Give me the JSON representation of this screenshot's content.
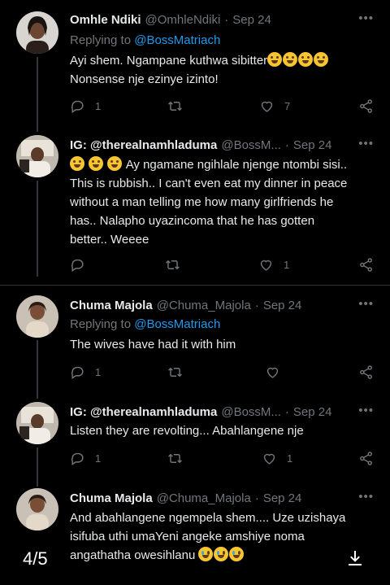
{
  "tweets": [
    {
      "name": "Omhle Ndiki",
      "handle": "@OmhleNdiki",
      "time": "Sep 24",
      "replying_prefix": "Replying to",
      "replying_to": "@BossMatriach",
      "lines": [
        "Ayi shem. Ngampane kuthwa sibitter",
        "Nonsense nje ezinye izinto!"
      ],
      "replies": "1",
      "retweets": "",
      "likes": "7"
    },
    {
      "name": "IG: @therealnamhladuma",
      "handle": "@BossM...",
      "time": "Sep 24",
      "lines": [
        "Ay ngamane ngihlale njenge ntombi sisi..",
        "This is rubbish.. I can't even eat my dinner in peace",
        "without a man telling me how many girlfriends he",
        "has.. Nalapho uyazincoma that he has gotten",
        "better.. Weeee"
      ],
      "replies": "",
      "retweets": "",
      "likes": "1"
    },
    {
      "name": "Chuma Majola",
      "handle": "@Chuma_Majola",
      "time": "Sep 24",
      "replying_prefix": "Replying to",
      "replying_to": "@BossMatriach",
      "lines": [
        "The wives have had it with him"
      ],
      "replies": "1",
      "retweets": "",
      "likes": ""
    },
    {
      "name": "IG: @therealnamhladuma",
      "handle": "@BossM...",
      "time": "Sep 24",
      "lines": [
        "Listen they are revolting... Abahlangene nje"
      ],
      "replies": "1",
      "retweets": "",
      "likes": "1"
    },
    {
      "name": "Chuma Majola",
      "handle": "@Chuma_Majola",
      "time": "Sep 24",
      "lines": [
        "And abahlangene ngempela shem.... Uze uzishaya",
        "isifuba uthi umaYeni angeke amshiye noma",
        "angathatha owesihlanu"
      ]
    }
  ],
  "viewer": {
    "counter": "4/5"
  },
  "colors": {
    "background": "#000000",
    "accent": "#1d9bf0",
    "muted": "#71767b",
    "text": "#e7e9ea"
  },
  "icons": [
    "reply-icon",
    "retweet-icon",
    "like-icon",
    "share-icon",
    "more-icon",
    "download-icon",
    "laughing-crying-emoji",
    "crying-emoji"
  ]
}
